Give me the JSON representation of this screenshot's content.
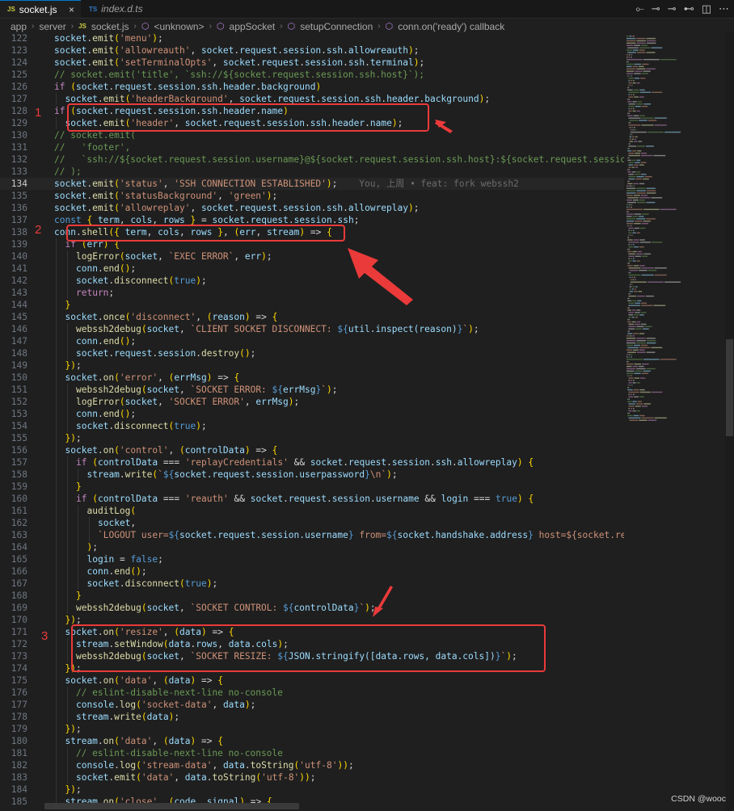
{
  "tabs": [
    {
      "label": "socket.js",
      "file_type": "JS",
      "close": "×",
      "active": true
    },
    {
      "label": "index.d.ts",
      "file_type": "TS",
      "active": false
    }
  ],
  "editor_actions": [
    "open-changes-icon",
    "previous-change-icon",
    "next-change-icon",
    "toggle-blame-icon",
    "split-editor-icon",
    "more-actions-icon"
  ],
  "breadcrumb": {
    "items": [
      "app",
      "server",
      "socket.js",
      "<unknown>",
      "appSocket",
      "setupConnection",
      "conn.on('ready') callback"
    ],
    "js_badge": "JS"
  },
  "blame_text": "You, 上周 • feat: fork webssh2",
  "annotations": [
    "1",
    "2",
    "3"
  ],
  "watermark": "CSDN @wooc",
  "lines": [
    {
      "n": "122",
      "t": "socket.emit('menu');"
    },
    {
      "n": "123",
      "t": "socket.emit('allowreauth', socket.request.session.ssh.allowreauth);"
    },
    {
      "n": "124",
      "t": "socket.emit('setTerminalOpts', socket.request.session.ssh.terminal);"
    },
    {
      "n": "125",
      "t": "// socket.emit('title', `ssh://${socket.request.session.ssh.host}`);"
    },
    {
      "n": "126",
      "t": "if (socket.request.session.ssh.header.background)"
    },
    {
      "n": "127",
      "t": "  socket.emit('headerBackground', socket.request.session.ssh.header.background);"
    },
    {
      "n": "128",
      "t": "if (socket.request.session.ssh.header.name)"
    },
    {
      "n": "129",
      "t": "  socket.emit('header', socket.request.session.ssh.header.name);"
    },
    {
      "n": "130",
      "t": "// socket.emit("
    },
    {
      "n": "131",
      "t": "//   'footer',"
    },
    {
      "n": "132",
      "t": "//   `ssh://${socket.request.session.username}@${socket.request.session.ssh.host}:${socket.request.session.ssh.por"
    },
    {
      "n": "133",
      "t": "// );"
    },
    {
      "n": "134",
      "t": "socket.emit('status', 'SSH CONNECTION ESTABLISHED');"
    },
    {
      "n": "135",
      "t": "socket.emit('statusBackground', 'green');"
    },
    {
      "n": "136",
      "t": "socket.emit('allowreplay', socket.request.session.ssh.allowreplay);"
    },
    {
      "n": "137",
      "t": "const { term, cols, rows } = socket.request.session.ssh;"
    },
    {
      "n": "138",
      "t": "conn.shell({ term, cols, rows }, (err, stream) => {"
    },
    {
      "n": "139",
      "t": "  if (err) {"
    },
    {
      "n": "140",
      "t": "    logError(socket, `EXEC ERROR`, err);"
    },
    {
      "n": "141",
      "t": "    conn.end();"
    },
    {
      "n": "142",
      "t": "    socket.disconnect(true);"
    },
    {
      "n": "143",
      "t": "    return;"
    },
    {
      "n": "144",
      "t": "  }"
    },
    {
      "n": "145",
      "t": "  socket.once('disconnect', (reason) => {"
    },
    {
      "n": "146",
      "t": "    webssh2debug(socket, `CLIENT SOCKET DISCONNECT: ${util.inspect(reason)}`);"
    },
    {
      "n": "147",
      "t": "    conn.end();"
    },
    {
      "n": "148",
      "t": "    socket.request.session.destroy();"
    },
    {
      "n": "149",
      "t": "  });"
    },
    {
      "n": "150",
      "t": "  socket.on('error', (errMsg) => {"
    },
    {
      "n": "151",
      "t": "    webssh2debug(socket, `SOCKET ERROR: ${errMsg}`);"
    },
    {
      "n": "152",
      "t": "    logError(socket, 'SOCKET ERROR', errMsg);"
    },
    {
      "n": "153",
      "t": "    conn.end();"
    },
    {
      "n": "154",
      "t": "    socket.disconnect(true);"
    },
    {
      "n": "155",
      "t": "  });"
    },
    {
      "n": "156",
      "t": "  socket.on('control', (controlData) => {"
    },
    {
      "n": "157",
      "t": "    if (controlData === 'replayCredentials' && socket.request.session.ssh.allowreplay) {"
    },
    {
      "n": "158",
      "t": "      stream.write(`${socket.request.session.userpassword}\\n`);"
    },
    {
      "n": "159",
      "t": "    }"
    },
    {
      "n": "160",
      "t": "    if (controlData === 'reauth' && socket.request.session.username && login === true) {"
    },
    {
      "n": "161",
      "t": "      auditLog("
    },
    {
      "n": "162",
      "t": "        socket,"
    },
    {
      "n": "163",
      "t": "        `LOGOUT user=${socket.request.session.username} from=${socket.handshake.address} host=${socket.request.sess"
    },
    {
      "n": "164",
      "t": "      );"
    },
    {
      "n": "165",
      "t": "      login = false;"
    },
    {
      "n": "166",
      "t": "      conn.end();"
    },
    {
      "n": "167",
      "t": "      socket.disconnect(true);"
    },
    {
      "n": "168",
      "t": "    }"
    },
    {
      "n": "169",
      "t": "    webssh2debug(socket, `SOCKET CONTROL: ${controlData}`);"
    },
    {
      "n": "170",
      "t": "  });"
    },
    {
      "n": "171",
      "t": "  socket.on('resize', (data) => {"
    },
    {
      "n": "172",
      "t": "    stream.setWindow(data.rows, data.cols);"
    },
    {
      "n": "173",
      "t": "    webssh2debug(socket, `SOCKET RESIZE: ${JSON.stringify([data.rows, data.cols])}`);"
    },
    {
      "n": "174",
      "t": "  });"
    },
    {
      "n": "175",
      "t": "  socket.on('data', (data) => {"
    },
    {
      "n": "176",
      "t": "    // eslint-disable-next-line no-console"
    },
    {
      "n": "177",
      "t": "    console.log('socket-data', data);"
    },
    {
      "n": "178",
      "t": "    stream.write(data);"
    },
    {
      "n": "179",
      "t": "  });"
    },
    {
      "n": "180",
      "t": "  stream.on('data', (data) => {"
    },
    {
      "n": "181",
      "t": "    // eslint-disable-next-line no-console"
    },
    {
      "n": "182",
      "t": "    console.log('stream-data', data.toString('utf-8'));"
    },
    {
      "n": "183",
      "t": "    socket.emit('data', data.toString('utf-8'));"
    },
    {
      "n": "184",
      "t": "  });"
    },
    {
      "n": "185",
      "t": "  stream.on('close', (code, signal) => {"
    }
  ],
  "current_line": "134",
  "colors": {
    "highlight": "#ea3a3a",
    "background": "#1f1f1f",
    "accent": "#0078d4"
  }
}
